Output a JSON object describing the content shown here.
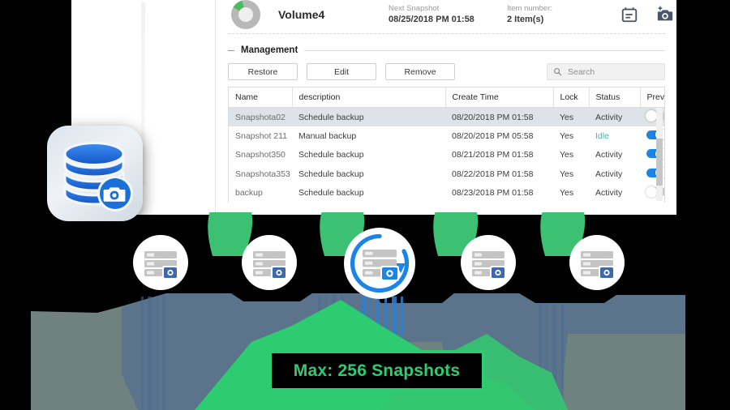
{
  "volume": {
    "name": "Volume4",
    "next_snapshot_label": "Next Snapshot",
    "next_snapshot_value": "08/25/2018 PM 01:58",
    "item_number_label": "Item number:",
    "item_number_value": "2 Item(s)",
    "calendar_icon": "calendar-icon",
    "add_snapshot_icon": "camera-plus-icon",
    "usage_used_pct": 12.5
  },
  "management": {
    "legend": "Management",
    "buttons": [
      {
        "label": "Restore",
        "name": "restore-button"
      },
      {
        "label": "Edit",
        "name": "edit-button"
      },
      {
        "label": "Remove",
        "name": "remove-button"
      }
    ],
    "search": {
      "placeholder": "Search",
      "value": "",
      "icon": "search-icon"
    }
  },
  "table": {
    "columns": [
      "Name",
      "description",
      "Create Time",
      "Lock",
      "Status",
      "Preview"
    ],
    "rows": [
      {
        "name": "Snapshota02",
        "description": "Schedule backup",
        "create_time": "08/20/2018 PM 01:58",
        "lock": "Yes",
        "status": "Activity",
        "status_state": "activity",
        "preview": false,
        "selected": true
      },
      {
        "name": "Snapshot 211",
        "description": "Manual backup",
        "create_time": "08/20/2018 PM 05:58",
        "lock": "Yes",
        "status": "Idle",
        "status_state": "idle",
        "preview": true,
        "selected": false
      },
      {
        "name": "Snapshot350",
        "description": "Schedule backup",
        "create_time": "08/21/2018 PM 01:58",
        "lock": "Yes",
        "status": "Activity",
        "status_state": "activity",
        "preview": true,
        "selected": false
      },
      {
        "name": "Snapshota353",
        "description": "Schedule backup",
        "create_time": "08/22/2018 PM 01:58",
        "lock": "Yes",
        "status": "Activity",
        "status_state": "activity",
        "preview": true,
        "selected": false
      },
      {
        "name": "backup",
        "description": "Schedule backup",
        "create_time": "08/23/2018 PM 01:58",
        "lock": "Yes",
        "status": "Activity",
        "status_state": "activity",
        "preview": false,
        "selected": false
      }
    ]
  },
  "app_icon": {
    "name": "database-snapshot-icon"
  },
  "nodes": [
    {
      "name": "snapshot-node-1",
      "center": false
    },
    {
      "name": "snapshot-node-2",
      "center": false
    },
    {
      "name": "snapshot-node-3",
      "center": true
    },
    {
      "name": "snapshot-node-4",
      "center": false
    },
    {
      "name": "snapshot-node-5",
      "center": false
    }
  ],
  "banner": {
    "text": "Max: 256 Snapshots",
    "border_color": "#2ecc71",
    "text_color": "#2ecc71",
    "background": "#000000"
  },
  "colors": {
    "accent_blue": "#1b84e7",
    "green": "#2ecc71",
    "idle_green": "#2ec79b",
    "grey": "#6d6d6d"
  }
}
